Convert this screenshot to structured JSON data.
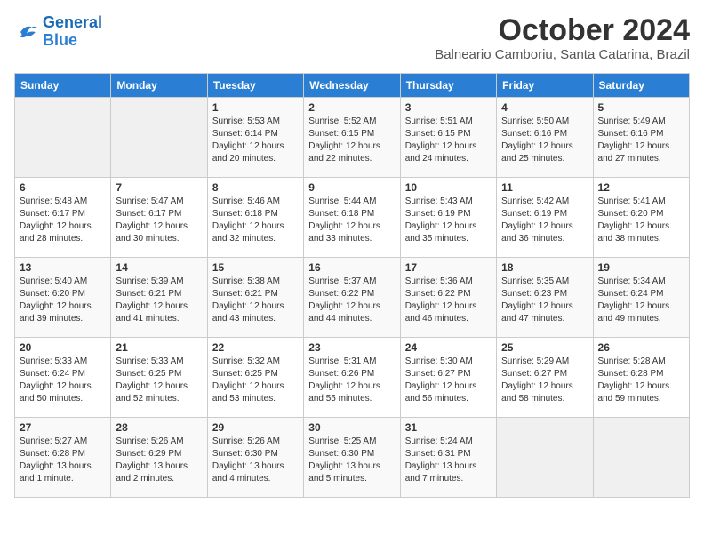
{
  "logo": {
    "line1": "General",
    "line2": "Blue"
  },
  "title": "October 2024",
  "subtitle": "Balneario Camboriu, Santa Catarina, Brazil",
  "headers": [
    "Sunday",
    "Monday",
    "Tuesday",
    "Wednesday",
    "Thursday",
    "Friday",
    "Saturday"
  ],
  "weeks": [
    [
      {
        "day": "",
        "info": ""
      },
      {
        "day": "",
        "info": ""
      },
      {
        "day": "1",
        "info": "Sunrise: 5:53 AM\nSunset: 6:14 PM\nDaylight: 12 hours and 20 minutes."
      },
      {
        "day": "2",
        "info": "Sunrise: 5:52 AM\nSunset: 6:15 PM\nDaylight: 12 hours and 22 minutes."
      },
      {
        "day": "3",
        "info": "Sunrise: 5:51 AM\nSunset: 6:15 PM\nDaylight: 12 hours and 24 minutes."
      },
      {
        "day": "4",
        "info": "Sunrise: 5:50 AM\nSunset: 6:16 PM\nDaylight: 12 hours and 25 minutes."
      },
      {
        "day": "5",
        "info": "Sunrise: 5:49 AM\nSunset: 6:16 PM\nDaylight: 12 hours and 27 minutes."
      }
    ],
    [
      {
        "day": "6",
        "info": "Sunrise: 5:48 AM\nSunset: 6:17 PM\nDaylight: 12 hours and 28 minutes."
      },
      {
        "day": "7",
        "info": "Sunrise: 5:47 AM\nSunset: 6:17 PM\nDaylight: 12 hours and 30 minutes."
      },
      {
        "day": "8",
        "info": "Sunrise: 5:46 AM\nSunset: 6:18 PM\nDaylight: 12 hours and 32 minutes."
      },
      {
        "day": "9",
        "info": "Sunrise: 5:44 AM\nSunset: 6:18 PM\nDaylight: 12 hours and 33 minutes."
      },
      {
        "day": "10",
        "info": "Sunrise: 5:43 AM\nSunset: 6:19 PM\nDaylight: 12 hours and 35 minutes."
      },
      {
        "day": "11",
        "info": "Sunrise: 5:42 AM\nSunset: 6:19 PM\nDaylight: 12 hours and 36 minutes."
      },
      {
        "day": "12",
        "info": "Sunrise: 5:41 AM\nSunset: 6:20 PM\nDaylight: 12 hours and 38 minutes."
      }
    ],
    [
      {
        "day": "13",
        "info": "Sunrise: 5:40 AM\nSunset: 6:20 PM\nDaylight: 12 hours and 39 minutes."
      },
      {
        "day": "14",
        "info": "Sunrise: 5:39 AM\nSunset: 6:21 PM\nDaylight: 12 hours and 41 minutes."
      },
      {
        "day": "15",
        "info": "Sunrise: 5:38 AM\nSunset: 6:21 PM\nDaylight: 12 hours and 43 minutes."
      },
      {
        "day": "16",
        "info": "Sunrise: 5:37 AM\nSunset: 6:22 PM\nDaylight: 12 hours and 44 minutes."
      },
      {
        "day": "17",
        "info": "Sunrise: 5:36 AM\nSunset: 6:22 PM\nDaylight: 12 hours and 46 minutes."
      },
      {
        "day": "18",
        "info": "Sunrise: 5:35 AM\nSunset: 6:23 PM\nDaylight: 12 hours and 47 minutes."
      },
      {
        "day": "19",
        "info": "Sunrise: 5:34 AM\nSunset: 6:24 PM\nDaylight: 12 hours and 49 minutes."
      }
    ],
    [
      {
        "day": "20",
        "info": "Sunrise: 5:33 AM\nSunset: 6:24 PM\nDaylight: 12 hours and 50 minutes."
      },
      {
        "day": "21",
        "info": "Sunrise: 5:33 AM\nSunset: 6:25 PM\nDaylight: 12 hours and 52 minutes."
      },
      {
        "day": "22",
        "info": "Sunrise: 5:32 AM\nSunset: 6:25 PM\nDaylight: 12 hours and 53 minutes."
      },
      {
        "day": "23",
        "info": "Sunrise: 5:31 AM\nSunset: 6:26 PM\nDaylight: 12 hours and 55 minutes."
      },
      {
        "day": "24",
        "info": "Sunrise: 5:30 AM\nSunset: 6:27 PM\nDaylight: 12 hours and 56 minutes."
      },
      {
        "day": "25",
        "info": "Sunrise: 5:29 AM\nSunset: 6:27 PM\nDaylight: 12 hours and 58 minutes."
      },
      {
        "day": "26",
        "info": "Sunrise: 5:28 AM\nSunset: 6:28 PM\nDaylight: 12 hours and 59 minutes."
      }
    ],
    [
      {
        "day": "27",
        "info": "Sunrise: 5:27 AM\nSunset: 6:28 PM\nDaylight: 13 hours and 1 minute."
      },
      {
        "day": "28",
        "info": "Sunrise: 5:26 AM\nSunset: 6:29 PM\nDaylight: 13 hours and 2 minutes."
      },
      {
        "day": "29",
        "info": "Sunrise: 5:26 AM\nSunset: 6:30 PM\nDaylight: 13 hours and 4 minutes."
      },
      {
        "day": "30",
        "info": "Sunrise: 5:25 AM\nSunset: 6:30 PM\nDaylight: 13 hours and 5 minutes."
      },
      {
        "day": "31",
        "info": "Sunrise: 5:24 AM\nSunset: 6:31 PM\nDaylight: 13 hours and 7 minutes."
      },
      {
        "day": "",
        "info": ""
      },
      {
        "day": "",
        "info": ""
      }
    ]
  ]
}
